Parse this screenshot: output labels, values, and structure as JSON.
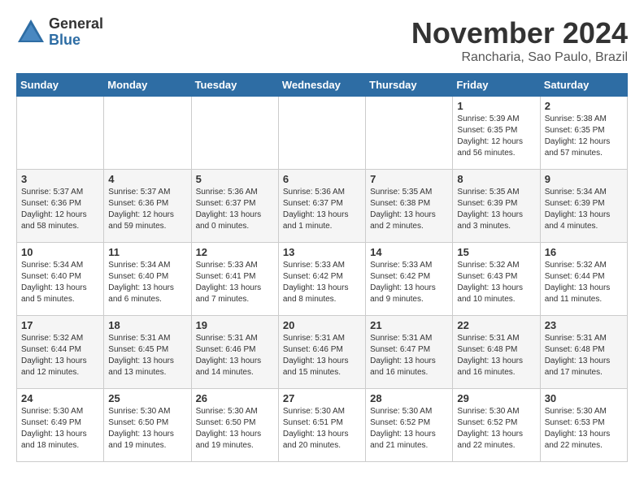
{
  "header": {
    "logo_general": "General",
    "logo_blue": "Blue",
    "month_title": "November 2024",
    "location": "Rancharia, Sao Paulo, Brazil"
  },
  "days_of_week": [
    "Sunday",
    "Monday",
    "Tuesday",
    "Wednesday",
    "Thursday",
    "Friday",
    "Saturday"
  ],
  "weeks": [
    [
      {
        "day": "",
        "info": ""
      },
      {
        "day": "",
        "info": ""
      },
      {
        "day": "",
        "info": ""
      },
      {
        "day": "",
        "info": ""
      },
      {
        "day": "",
        "info": ""
      },
      {
        "day": "1",
        "info": "Sunrise: 5:39 AM\nSunset: 6:35 PM\nDaylight: 12 hours and 56 minutes."
      },
      {
        "day": "2",
        "info": "Sunrise: 5:38 AM\nSunset: 6:35 PM\nDaylight: 12 hours and 57 minutes."
      }
    ],
    [
      {
        "day": "3",
        "info": "Sunrise: 5:37 AM\nSunset: 6:36 PM\nDaylight: 12 hours and 58 minutes."
      },
      {
        "day": "4",
        "info": "Sunrise: 5:37 AM\nSunset: 6:36 PM\nDaylight: 12 hours and 59 minutes."
      },
      {
        "day": "5",
        "info": "Sunrise: 5:36 AM\nSunset: 6:37 PM\nDaylight: 13 hours and 0 minutes."
      },
      {
        "day": "6",
        "info": "Sunrise: 5:36 AM\nSunset: 6:37 PM\nDaylight: 13 hours and 1 minute."
      },
      {
        "day": "7",
        "info": "Sunrise: 5:35 AM\nSunset: 6:38 PM\nDaylight: 13 hours and 2 minutes."
      },
      {
        "day": "8",
        "info": "Sunrise: 5:35 AM\nSunset: 6:39 PM\nDaylight: 13 hours and 3 minutes."
      },
      {
        "day": "9",
        "info": "Sunrise: 5:34 AM\nSunset: 6:39 PM\nDaylight: 13 hours and 4 minutes."
      }
    ],
    [
      {
        "day": "10",
        "info": "Sunrise: 5:34 AM\nSunset: 6:40 PM\nDaylight: 13 hours and 5 minutes."
      },
      {
        "day": "11",
        "info": "Sunrise: 5:34 AM\nSunset: 6:40 PM\nDaylight: 13 hours and 6 minutes."
      },
      {
        "day": "12",
        "info": "Sunrise: 5:33 AM\nSunset: 6:41 PM\nDaylight: 13 hours and 7 minutes."
      },
      {
        "day": "13",
        "info": "Sunrise: 5:33 AM\nSunset: 6:42 PM\nDaylight: 13 hours and 8 minutes."
      },
      {
        "day": "14",
        "info": "Sunrise: 5:33 AM\nSunset: 6:42 PM\nDaylight: 13 hours and 9 minutes."
      },
      {
        "day": "15",
        "info": "Sunrise: 5:32 AM\nSunset: 6:43 PM\nDaylight: 13 hours and 10 minutes."
      },
      {
        "day": "16",
        "info": "Sunrise: 5:32 AM\nSunset: 6:44 PM\nDaylight: 13 hours and 11 minutes."
      }
    ],
    [
      {
        "day": "17",
        "info": "Sunrise: 5:32 AM\nSunset: 6:44 PM\nDaylight: 13 hours and 12 minutes."
      },
      {
        "day": "18",
        "info": "Sunrise: 5:31 AM\nSunset: 6:45 PM\nDaylight: 13 hours and 13 minutes."
      },
      {
        "day": "19",
        "info": "Sunrise: 5:31 AM\nSunset: 6:46 PM\nDaylight: 13 hours and 14 minutes."
      },
      {
        "day": "20",
        "info": "Sunrise: 5:31 AM\nSunset: 6:46 PM\nDaylight: 13 hours and 15 minutes."
      },
      {
        "day": "21",
        "info": "Sunrise: 5:31 AM\nSunset: 6:47 PM\nDaylight: 13 hours and 16 minutes."
      },
      {
        "day": "22",
        "info": "Sunrise: 5:31 AM\nSunset: 6:48 PM\nDaylight: 13 hours and 16 minutes."
      },
      {
        "day": "23",
        "info": "Sunrise: 5:31 AM\nSunset: 6:48 PM\nDaylight: 13 hours and 17 minutes."
      }
    ],
    [
      {
        "day": "24",
        "info": "Sunrise: 5:30 AM\nSunset: 6:49 PM\nDaylight: 13 hours and 18 minutes."
      },
      {
        "day": "25",
        "info": "Sunrise: 5:30 AM\nSunset: 6:50 PM\nDaylight: 13 hours and 19 minutes."
      },
      {
        "day": "26",
        "info": "Sunrise: 5:30 AM\nSunset: 6:50 PM\nDaylight: 13 hours and 19 minutes."
      },
      {
        "day": "27",
        "info": "Sunrise: 5:30 AM\nSunset: 6:51 PM\nDaylight: 13 hours and 20 minutes."
      },
      {
        "day": "28",
        "info": "Sunrise: 5:30 AM\nSunset: 6:52 PM\nDaylight: 13 hours and 21 minutes."
      },
      {
        "day": "29",
        "info": "Sunrise: 5:30 AM\nSunset: 6:52 PM\nDaylight: 13 hours and 22 minutes."
      },
      {
        "day": "30",
        "info": "Sunrise: 5:30 AM\nSunset: 6:53 PM\nDaylight: 13 hours and 22 minutes."
      }
    ]
  ]
}
